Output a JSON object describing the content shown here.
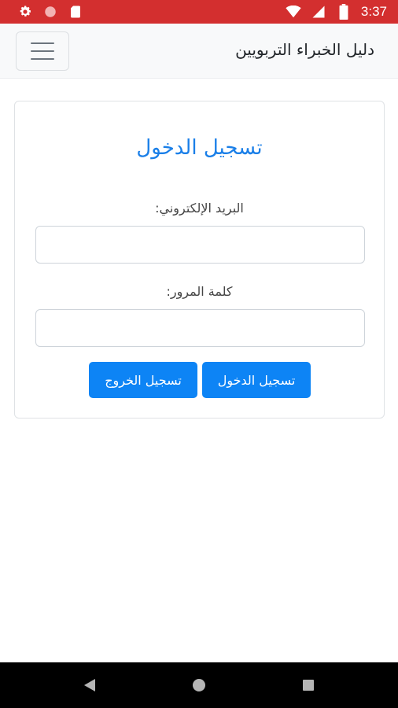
{
  "status_bar": {
    "time": "3:37",
    "icons_left": [
      "gear-icon",
      "circle-icon",
      "sim-card-icon"
    ],
    "icons_right": [
      "wifi-icon",
      "signal-icon",
      "battery-icon"
    ],
    "color": "#d32f2f"
  },
  "navbar": {
    "brand": "دليل الخبراء التربويين",
    "menu_icon": "hamburger-menu-icon"
  },
  "login_card": {
    "title": "تسجيل الدخول",
    "email_label": "البريد الإلكتروني:",
    "email_value": "",
    "password_label": "كلمة المرور:",
    "password_value": "",
    "login_button": "تسجيل الدخول",
    "logout_button": "تسجيل الخروج",
    "accent_color": "#0d84f5"
  },
  "system_nav": {
    "icons": [
      "back-icon",
      "home-icon",
      "recents-icon"
    ]
  }
}
